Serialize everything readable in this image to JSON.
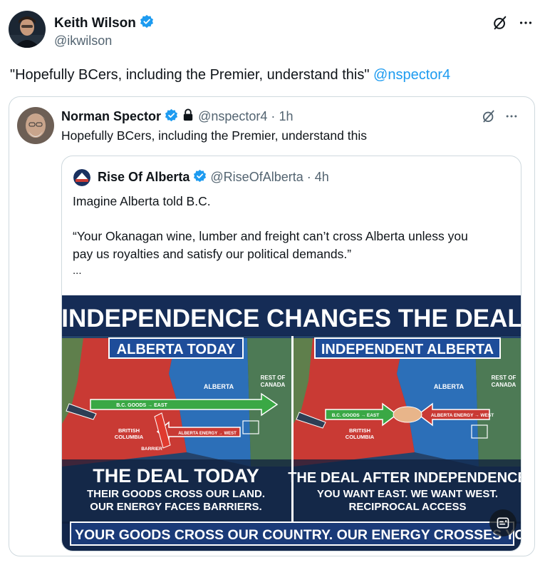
{
  "main_tweet": {
    "author_name": "Keith Wilson",
    "author_handle": "@ikwilson",
    "text": "\"Hopefully BCers, including the Premier, understand this\" ",
    "mention": "@nspector4",
    "icons": [
      "grok-icon",
      "more-icon",
      "verified-badge-icon"
    ]
  },
  "quoted_tweet": {
    "author_name": "Norman Spector",
    "author_handle": "@nspector4",
    "separator": "·",
    "time": "1h",
    "text": "Hopefully BCers, including the Premier, understand this",
    "icons": [
      "verified-badge-icon",
      "lock-icon",
      "grok-icon",
      "more-icon"
    ]
  },
  "nested_tweet": {
    "author_name": "Rise Of Alberta",
    "author_handle": "@RiseOfAlberta",
    "separator": "·",
    "time": "4h",
    "line1": "Imagine Alberta told B.C.",
    "line2": "“Your Okanagan wine, lumber and freight can’t cross Alberta unless you",
    "line3": "pay us royalties and satisfy our political demands.”",
    "ellipsis": "...",
    "icons": [
      "verified-badge-icon"
    ]
  },
  "infographic": {
    "title": "INDEPENDENCE CHANGES THE DEAL",
    "left_panel": {
      "header": "ALBERTA TODAY",
      "map_labels": {
        "alberta": "ALBERTA",
        "rest_of_canada_1": "REST OF",
        "rest_of_canada_2": "CANADA",
        "bc_goods": "B.C. GOODS → EAST",
        "alberta_energy": "ALBERTA ENERGY → WEST",
        "british_1": "BRITISH",
        "columbia": "COLUMBIA",
        "barrier": "BARRIER"
      },
      "deal_title": "THE DEAL TODAY",
      "deal_line1": "THEIR GOODS CROSS OUR LAND.",
      "deal_line2": "OUR ENERGY FACES BARRIERS."
    },
    "right_panel": {
      "header": "INDEPENDENT ALBERTA",
      "map_labels": {
        "alberta": "ALBERTA",
        "rest_of_canada_1": "REST OF",
        "rest_of_canada_2": "CANADA",
        "bc_goods": "B.C. GOODS → EAST",
        "alberta_energy": "ALBERTA ENERGY → WEST",
        "british_1": "BRITISH",
        "columbia": "COLUMBIA"
      },
      "deal_title": "THE DEAL AFTER INDEPENDENCE",
      "deal_line1": "YOU WANT EAST. WE WANT WEST.",
      "deal_line2": "RECIPROCAL ACCESS"
    },
    "footer": "YOUR GOODS CROSS OUR COUNTRY. OUR ENERGY CROSSES YOUI",
    "icons": [
      "image-text-icon"
    ]
  },
  "colors": {
    "link": "#1d9bf0",
    "verified": "#1d9bf0",
    "border": "#cfd9de",
    "muted": "#536471",
    "info_navy": "#12264a",
    "info_red": "#c93a34",
    "info_blue": "#2c6fb8"
  }
}
